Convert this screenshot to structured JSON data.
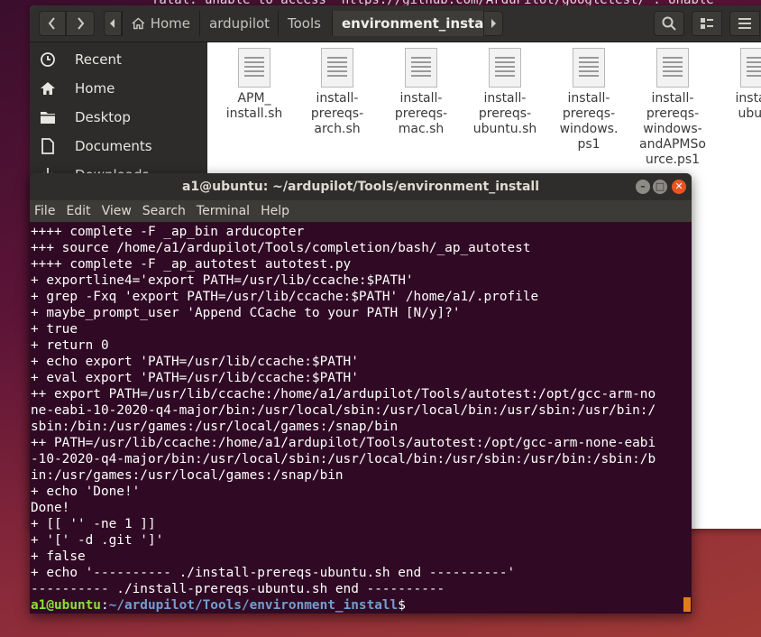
{
  "background_terminal": {
    "text": "fatal: unable to access 'https://github.com/ArduPilot/googletest/': Unable"
  },
  "file_manager": {
    "breadcrumbs": [
      "Home",
      "ardupilot",
      "Tools",
      "environment_install"
    ],
    "sidebar": [
      {
        "label": "Recent",
        "icon": "clock-icon"
      },
      {
        "label": "Home",
        "icon": "home-icon"
      },
      {
        "label": "Desktop",
        "icon": "folder-icon"
      },
      {
        "label": "Documents",
        "icon": "document-icon"
      },
      {
        "label": "Downloads",
        "icon": "download-icon"
      }
    ],
    "files": [
      {
        "name": "APM_\ninstall.sh"
      },
      {
        "name": "install-\nprereqs-\narch.sh"
      },
      {
        "name": "install-\nprereqs-\nmac.sh"
      },
      {
        "name": "install-\nprereqs-\nubuntu.sh"
      },
      {
        "name": "install-\nprereqs-\nwindows.\nps1"
      },
      {
        "name": "install-\nprereqs-\nwindows-\nandAPMSo\nurce.ps1"
      },
      {
        "name": "install-\nubunt"
      }
    ]
  },
  "terminal": {
    "title": "a1@ubuntu: ~/ardupilot/Tools/environment_install",
    "menu": [
      "File",
      "Edit",
      "View",
      "Search",
      "Terminal",
      "Help"
    ],
    "lines": [
      "++++ complete -F _ap_bin arducopter",
      "+++ source /home/a1/ardupilot/Tools/completion/bash/_ap_autotest",
      "++++ complete -F _ap_autotest autotest.py",
      "+ exportline4='export PATH=/usr/lib/ccache:$PATH'",
      "+ grep -Fxq 'export PATH=/usr/lib/ccache:$PATH' /home/a1/.profile",
      "+ maybe_prompt_user 'Append CCache to your PATH [N/y]?'",
      "+ true",
      "+ return 0",
      "+ echo export 'PATH=/usr/lib/ccache:$PATH'",
      "+ eval export 'PATH=/usr/lib/ccache:$PATH'",
      "++ export PATH=/usr/lib/ccache:/home/a1/ardupilot/Tools/autotest:/opt/gcc-arm-no",
      "ne-eabi-10-2020-q4-major/bin:/usr/local/sbin:/usr/local/bin:/usr/sbin:/usr/bin:/",
      "sbin:/bin:/usr/games:/usr/local/games:/snap/bin",
      "++ PATH=/usr/lib/ccache:/home/a1/ardupilot/Tools/autotest:/opt/gcc-arm-none-eabi",
      "-10-2020-q4-major/bin:/usr/local/sbin:/usr/local/bin:/usr/sbin:/usr/bin:/sbin:/b",
      "in:/usr/games:/usr/local/games:/snap/bin",
      "+ echo 'Done!'",
      "Done!",
      "+ [[ '' -ne 1 ]]",
      "+ '[' -d .git ']'",
      "+ false",
      "+ echo '---------- ./install-prereqs-ubuntu.sh end ----------'",
      "---------- ./install-prereqs-ubuntu.sh end ----------"
    ],
    "prompt_user": "a1@ubuntu",
    "prompt_sep": ":",
    "prompt_path": "~/ardupilot/Tools/environment_install",
    "prompt_end": "$"
  },
  "colors": {
    "terminal_bg": "#300a24",
    "prompt_user": "#8ae234",
    "prompt_path": "#729fcf",
    "close_button": "#e95420",
    "cursor": "#e27c1a"
  }
}
